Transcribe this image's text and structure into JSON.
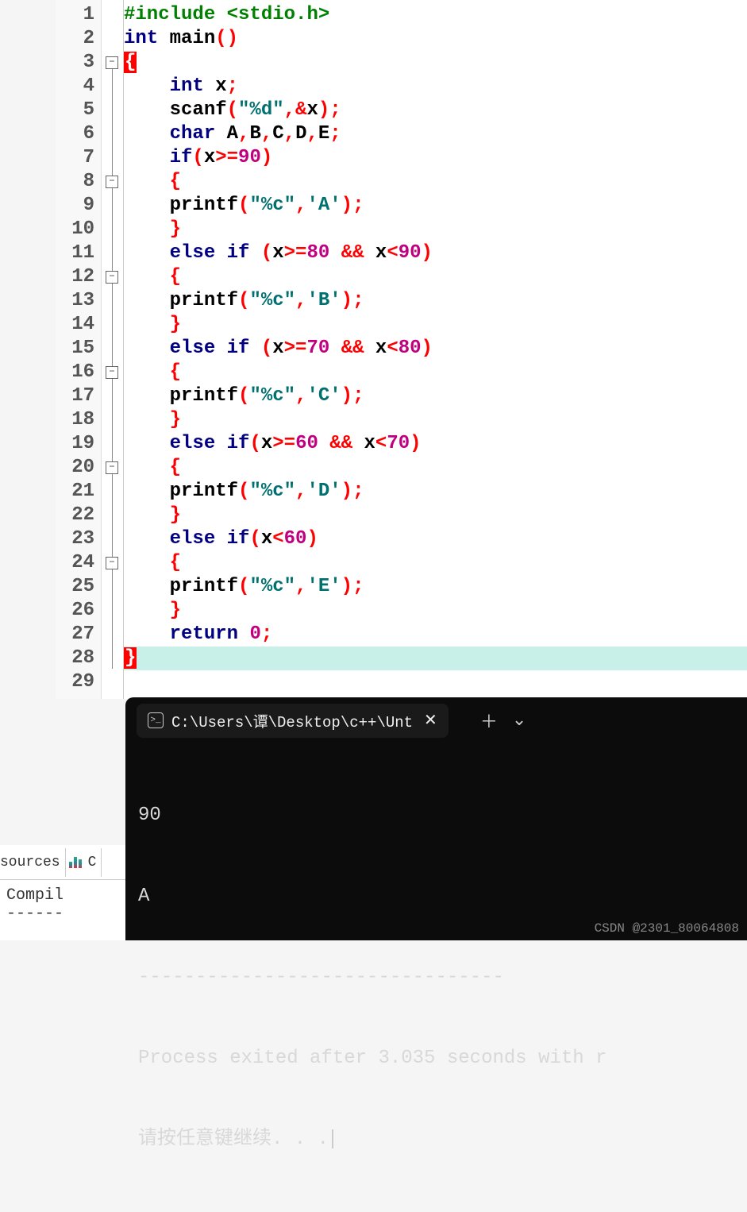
{
  "editor": {
    "line_count": 29,
    "fold_boxes": [
      {
        "line": 3
      },
      {
        "line": 8
      },
      {
        "line": 12
      },
      {
        "line": 16
      },
      {
        "line": 20
      },
      {
        "line": 24
      }
    ],
    "highlighted_line": 28,
    "lines": [
      [
        {
          "c": "tk-pre",
          "t": "#include"
        },
        {
          "c": "tk-id",
          "t": " "
        },
        {
          "c": "tk-pre",
          "t": "<stdio.h>"
        }
      ],
      [
        {
          "c": "tk-kw",
          "t": "int"
        },
        {
          "c": "tk-id",
          "t": " main"
        },
        {
          "c": "tk-pun",
          "t": "()"
        }
      ],
      [
        {
          "c": "cursor-mark",
          "t": "{"
        }
      ],
      [
        {
          "c": "tk-id",
          "t": "    "
        },
        {
          "c": "tk-kw",
          "t": "int"
        },
        {
          "c": "tk-id",
          "t": " x"
        },
        {
          "c": "tk-pun",
          "t": ";"
        }
      ],
      [
        {
          "c": "tk-id",
          "t": "    scanf"
        },
        {
          "c": "tk-pun",
          "t": "("
        },
        {
          "c": "tk-str",
          "t": "\"%d\""
        },
        {
          "c": "tk-pun",
          "t": ","
        },
        {
          "c": "tk-op",
          "t": "&"
        },
        {
          "c": "tk-id",
          "t": "x"
        },
        {
          "c": "tk-pun",
          "t": ");"
        }
      ],
      [
        {
          "c": "tk-id",
          "t": "    "
        },
        {
          "c": "tk-kw",
          "t": "char"
        },
        {
          "c": "tk-id",
          "t": " A"
        },
        {
          "c": "tk-pun",
          "t": ","
        },
        {
          "c": "tk-id",
          "t": "B"
        },
        {
          "c": "tk-pun",
          "t": ","
        },
        {
          "c": "tk-id",
          "t": "C"
        },
        {
          "c": "tk-pun",
          "t": ","
        },
        {
          "c": "tk-id",
          "t": "D"
        },
        {
          "c": "tk-pun",
          "t": ","
        },
        {
          "c": "tk-id",
          "t": "E"
        },
        {
          "c": "tk-pun",
          "t": ";"
        }
      ],
      [
        {
          "c": "tk-id",
          "t": "    "
        },
        {
          "c": "tk-kw",
          "t": "if"
        },
        {
          "c": "tk-pun",
          "t": "("
        },
        {
          "c": "tk-id",
          "t": "x"
        },
        {
          "c": "tk-op",
          "t": ">="
        },
        {
          "c": "tk-num",
          "t": "90"
        },
        {
          "c": "tk-pun",
          "t": ")"
        }
      ],
      [
        {
          "c": "tk-id",
          "t": "    "
        },
        {
          "c": "tk-br",
          "t": "{"
        }
      ],
      [
        {
          "c": "tk-id",
          "t": "    printf"
        },
        {
          "c": "tk-pun",
          "t": "("
        },
        {
          "c": "tk-str",
          "t": "\"%c\""
        },
        {
          "c": "tk-pun",
          "t": ","
        },
        {
          "c": "tk-str",
          "t": "'A'"
        },
        {
          "c": "tk-pun",
          "t": ");"
        }
      ],
      [
        {
          "c": "tk-id",
          "t": "    "
        },
        {
          "c": "tk-br",
          "t": "}"
        }
      ],
      [
        {
          "c": "tk-id",
          "t": "    "
        },
        {
          "c": "tk-kw",
          "t": "else if"
        },
        {
          "c": "tk-id",
          "t": " "
        },
        {
          "c": "tk-pun",
          "t": "("
        },
        {
          "c": "tk-id",
          "t": "x"
        },
        {
          "c": "tk-op",
          "t": ">="
        },
        {
          "c": "tk-num",
          "t": "80"
        },
        {
          "c": "tk-id",
          "t": " "
        },
        {
          "c": "tk-op",
          "t": "&&"
        },
        {
          "c": "tk-id",
          "t": " x"
        },
        {
          "c": "tk-op",
          "t": "<"
        },
        {
          "c": "tk-num",
          "t": "90"
        },
        {
          "c": "tk-pun",
          "t": ")"
        }
      ],
      [
        {
          "c": "tk-id",
          "t": "    "
        },
        {
          "c": "tk-br",
          "t": "{"
        }
      ],
      [
        {
          "c": "tk-id",
          "t": "    printf"
        },
        {
          "c": "tk-pun",
          "t": "("
        },
        {
          "c": "tk-str",
          "t": "\"%c\""
        },
        {
          "c": "tk-pun",
          "t": ","
        },
        {
          "c": "tk-str",
          "t": "'B'"
        },
        {
          "c": "tk-pun",
          "t": ");"
        }
      ],
      [
        {
          "c": "tk-id",
          "t": "    "
        },
        {
          "c": "tk-br",
          "t": "}"
        }
      ],
      [
        {
          "c": "tk-id",
          "t": "    "
        },
        {
          "c": "tk-kw",
          "t": "else if"
        },
        {
          "c": "tk-id",
          "t": " "
        },
        {
          "c": "tk-pun",
          "t": "("
        },
        {
          "c": "tk-id",
          "t": "x"
        },
        {
          "c": "tk-op",
          "t": ">="
        },
        {
          "c": "tk-num",
          "t": "70"
        },
        {
          "c": "tk-id",
          "t": " "
        },
        {
          "c": "tk-op",
          "t": "&&"
        },
        {
          "c": "tk-id",
          "t": " x"
        },
        {
          "c": "tk-op",
          "t": "<"
        },
        {
          "c": "tk-num",
          "t": "80"
        },
        {
          "c": "tk-pun",
          "t": ")"
        }
      ],
      [
        {
          "c": "tk-id",
          "t": "    "
        },
        {
          "c": "tk-br",
          "t": "{"
        }
      ],
      [
        {
          "c": "tk-id",
          "t": "    printf"
        },
        {
          "c": "tk-pun",
          "t": "("
        },
        {
          "c": "tk-str",
          "t": "\"%c\""
        },
        {
          "c": "tk-pun",
          "t": ","
        },
        {
          "c": "tk-str",
          "t": "'C'"
        },
        {
          "c": "tk-pun",
          "t": ");"
        }
      ],
      [
        {
          "c": "tk-id",
          "t": "    "
        },
        {
          "c": "tk-br",
          "t": "}"
        }
      ],
      [
        {
          "c": "tk-id",
          "t": "    "
        },
        {
          "c": "tk-kw",
          "t": "else if"
        },
        {
          "c": "tk-pun",
          "t": "("
        },
        {
          "c": "tk-id",
          "t": "x"
        },
        {
          "c": "tk-op",
          "t": ">="
        },
        {
          "c": "tk-num",
          "t": "60"
        },
        {
          "c": "tk-id",
          "t": " "
        },
        {
          "c": "tk-op",
          "t": "&&"
        },
        {
          "c": "tk-id",
          "t": " x"
        },
        {
          "c": "tk-op",
          "t": "<"
        },
        {
          "c": "tk-num",
          "t": "70"
        },
        {
          "c": "tk-pun",
          "t": ")"
        }
      ],
      [
        {
          "c": "tk-id",
          "t": "    "
        },
        {
          "c": "tk-br",
          "t": "{"
        }
      ],
      [
        {
          "c": "tk-id",
          "t": "    printf"
        },
        {
          "c": "tk-pun",
          "t": "("
        },
        {
          "c": "tk-str",
          "t": "\"%c\""
        },
        {
          "c": "tk-pun",
          "t": ","
        },
        {
          "c": "tk-str",
          "t": "'D'"
        },
        {
          "c": "tk-pun",
          "t": ");"
        }
      ],
      [
        {
          "c": "tk-id",
          "t": "    "
        },
        {
          "c": "tk-br",
          "t": "}"
        }
      ],
      [
        {
          "c": "tk-id",
          "t": "    "
        },
        {
          "c": "tk-kw",
          "t": "else if"
        },
        {
          "c": "tk-pun",
          "t": "("
        },
        {
          "c": "tk-id",
          "t": "x"
        },
        {
          "c": "tk-op",
          "t": "<"
        },
        {
          "c": "tk-num",
          "t": "60"
        },
        {
          "c": "tk-pun",
          "t": ")"
        }
      ],
      [
        {
          "c": "tk-id",
          "t": "    "
        },
        {
          "c": "tk-br",
          "t": "{"
        }
      ],
      [
        {
          "c": "tk-id",
          "t": "    printf"
        },
        {
          "c": "tk-pun",
          "t": "("
        },
        {
          "c": "tk-str",
          "t": "\"%c\""
        },
        {
          "c": "tk-pun",
          "t": ","
        },
        {
          "c": "tk-str",
          "t": "'E'"
        },
        {
          "c": "tk-pun",
          "t": ");"
        }
      ],
      [
        {
          "c": "tk-id",
          "t": "    "
        },
        {
          "c": "tk-br",
          "t": "}"
        }
      ],
      [
        {
          "c": "tk-id",
          "t": "    "
        },
        {
          "c": "tk-kw",
          "t": "return"
        },
        {
          "c": "tk-id",
          "t": " "
        },
        {
          "c": "tk-num",
          "t": "0"
        },
        {
          "c": "tk-pun",
          "t": ";"
        }
      ],
      [
        {
          "c": "cursor-mark",
          "t": "}"
        }
      ],
      []
    ]
  },
  "terminal": {
    "tab_title": "C:\\Users\\谭\\Desktop\\c++\\Unt",
    "input_line": "90",
    "output_line": "A",
    "divider": "--------------------------------",
    "exit_msg": "Process exited after 3.035 seconds with r",
    "continue_msg": "请按任意键继续. . .",
    "watermark": "CSDN @2301_80064808"
  },
  "bottom_tabs": {
    "tab1": "sources",
    "tab2": "C",
    "panel_label": "Compil",
    "dashes": "------"
  }
}
